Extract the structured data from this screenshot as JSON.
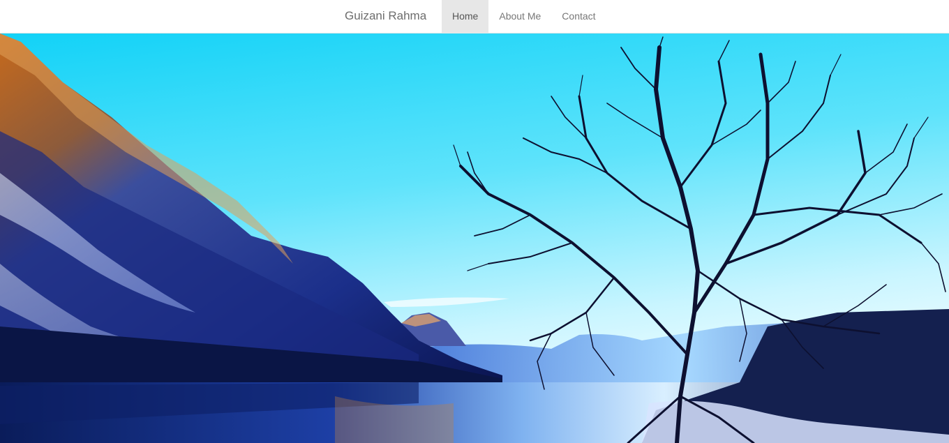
{
  "navbar": {
    "brand": "Guizani Rahma",
    "items": [
      {
        "label": "Home",
        "active": true
      },
      {
        "label": "About Me",
        "active": false
      },
      {
        "label": "Contact",
        "active": false
      }
    ]
  },
  "colors": {
    "nav_background": "#ffffff",
    "nav_active_background": "#e7e7e7",
    "nav_text": "#777777",
    "sky_top": "#1fd4f5",
    "sky_bottom": "#e9fbff",
    "lake": "#1b3f9e"
  }
}
